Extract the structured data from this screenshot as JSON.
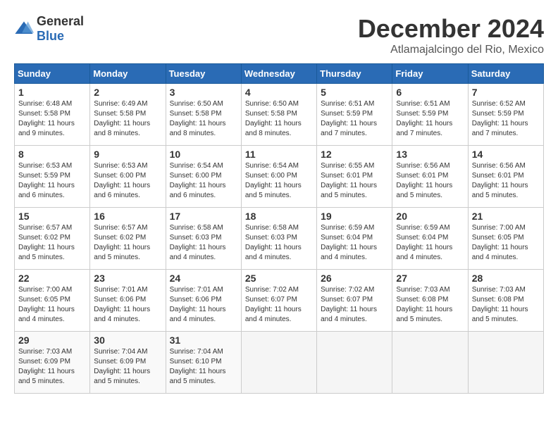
{
  "logo": {
    "general": "General",
    "blue": "Blue"
  },
  "title": {
    "month": "December 2024",
    "location": "Atlamajalcingo del Rio, Mexico"
  },
  "headers": [
    "Sunday",
    "Monday",
    "Tuesday",
    "Wednesday",
    "Thursday",
    "Friday",
    "Saturday"
  ],
  "weeks": [
    [
      {
        "day": "1",
        "sunrise": "6:48 AM",
        "sunset": "5:58 PM",
        "daylight": "11 hours and 9 minutes."
      },
      {
        "day": "2",
        "sunrise": "6:49 AM",
        "sunset": "5:58 PM",
        "daylight": "11 hours and 8 minutes."
      },
      {
        "day": "3",
        "sunrise": "6:50 AM",
        "sunset": "5:58 PM",
        "daylight": "11 hours and 8 minutes."
      },
      {
        "day": "4",
        "sunrise": "6:50 AM",
        "sunset": "5:58 PM",
        "daylight": "11 hours and 8 minutes."
      },
      {
        "day": "5",
        "sunrise": "6:51 AM",
        "sunset": "5:59 PM",
        "daylight": "11 hours and 7 minutes."
      },
      {
        "day": "6",
        "sunrise": "6:51 AM",
        "sunset": "5:59 PM",
        "daylight": "11 hours and 7 minutes."
      },
      {
        "day": "7",
        "sunrise": "6:52 AM",
        "sunset": "5:59 PM",
        "daylight": "11 hours and 7 minutes."
      }
    ],
    [
      {
        "day": "8",
        "sunrise": "6:53 AM",
        "sunset": "5:59 PM",
        "daylight": "11 hours and 6 minutes."
      },
      {
        "day": "9",
        "sunrise": "6:53 AM",
        "sunset": "6:00 PM",
        "daylight": "11 hours and 6 minutes."
      },
      {
        "day": "10",
        "sunrise": "6:54 AM",
        "sunset": "6:00 PM",
        "daylight": "11 hours and 6 minutes."
      },
      {
        "day": "11",
        "sunrise": "6:54 AM",
        "sunset": "6:00 PM",
        "daylight": "11 hours and 5 minutes."
      },
      {
        "day": "12",
        "sunrise": "6:55 AM",
        "sunset": "6:01 PM",
        "daylight": "11 hours and 5 minutes."
      },
      {
        "day": "13",
        "sunrise": "6:56 AM",
        "sunset": "6:01 PM",
        "daylight": "11 hours and 5 minutes."
      },
      {
        "day": "14",
        "sunrise": "6:56 AM",
        "sunset": "6:01 PM",
        "daylight": "11 hours and 5 minutes."
      }
    ],
    [
      {
        "day": "15",
        "sunrise": "6:57 AM",
        "sunset": "6:02 PM",
        "daylight": "11 hours and 5 minutes."
      },
      {
        "day": "16",
        "sunrise": "6:57 AM",
        "sunset": "6:02 PM",
        "daylight": "11 hours and 5 minutes."
      },
      {
        "day": "17",
        "sunrise": "6:58 AM",
        "sunset": "6:03 PM",
        "daylight": "11 hours and 4 minutes."
      },
      {
        "day": "18",
        "sunrise": "6:58 AM",
        "sunset": "6:03 PM",
        "daylight": "11 hours and 4 minutes."
      },
      {
        "day": "19",
        "sunrise": "6:59 AM",
        "sunset": "6:04 PM",
        "daylight": "11 hours and 4 minutes."
      },
      {
        "day": "20",
        "sunrise": "6:59 AM",
        "sunset": "6:04 PM",
        "daylight": "11 hours and 4 minutes."
      },
      {
        "day": "21",
        "sunrise": "7:00 AM",
        "sunset": "6:05 PM",
        "daylight": "11 hours and 4 minutes."
      }
    ],
    [
      {
        "day": "22",
        "sunrise": "7:00 AM",
        "sunset": "6:05 PM",
        "daylight": "11 hours and 4 minutes."
      },
      {
        "day": "23",
        "sunrise": "7:01 AM",
        "sunset": "6:06 PM",
        "daylight": "11 hours and 4 minutes."
      },
      {
        "day": "24",
        "sunrise": "7:01 AM",
        "sunset": "6:06 PM",
        "daylight": "11 hours and 4 minutes."
      },
      {
        "day": "25",
        "sunrise": "7:02 AM",
        "sunset": "6:07 PM",
        "daylight": "11 hours and 4 minutes."
      },
      {
        "day": "26",
        "sunrise": "7:02 AM",
        "sunset": "6:07 PM",
        "daylight": "11 hours and 4 minutes."
      },
      {
        "day": "27",
        "sunrise": "7:03 AM",
        "sunset": "6:08 PM",
        "daylight": "11 hours and 5 minutes."
      },
      {
        "day": "28",
        "sunrise": "7:03 AM",
        "sunset": "6:08 PM",
        "daylight": "11 hours and 5 minutes."
      }
    ],
    [
      {
        "day": "29",
        "sunrise": "7:03 AM",
        "sunset": "6:09 PM",
        "daylight": "11 hours and 5 minutes."
      },
      {
        "day": "30",
        "sunrise": "7:04 AM",
        "sunset": "6:09 PM",
        "daylight": "11 hours and 5 minutes."
      },
      {
        "day": "31",
        "sunrise": "7:04 AM",
        "sunset": "6:10 PM",
        "daylight": "11 hours and 5 minutes."
      },
      null,
      null,
      null,
      null
    ]
  ]
}
